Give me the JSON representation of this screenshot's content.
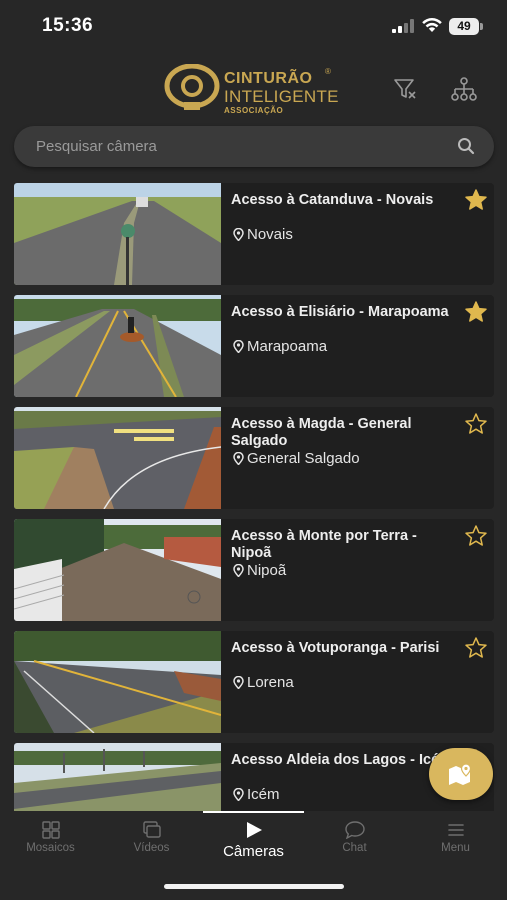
{
  "status_bar": {
    "time": "15:36",
    "battery": "49"
  },
  "header": {
    "logo_line1": "CINTURÃO",
    "logo_line2": "INTELIGENTE",
    "logo_line3": "ASSOCIAÇÃO",
    "logo_reg": "®"
  },
  "search": {
    "placeholder": "Pesquisar câmera"
  },
  "cameras": [
    {
      "title": "Acesso à Catanduva - Novais",
      "location": "Novais",
      "favorite": true
    },
    {
      "title": "Acesso à Elisiário - Marapoama",
      "location": "Marapoama",
      "favorite": true
    },
    {
      "title": "Acesso à Magda - General Salgado",
      "location": "General Salgado",
      "favorite": false
    },
    {
      "title": "Acesso à Monte por Terra - Nipoã",
      "location": "Nipoã",
      "favorite": false
    },
    {
      "title": "Acesso à Votuporanga - Parisi",
      "location": "Lorena",
      "favorite": false
    },
    {
      "title": "Acesso Aldeia dos Lagos - Icém",
      "location": "Icém",
      "favorite": false
    }
  ],
  "nav": {
    "items": [
      {
        "label": "Mosaicos",
        "icon": "grid-icon"
      },
      {
        "label": "Vídeos",
        "icon": "videos-icon"
      },
      {
        "label": "Câmeras",
        "icon": "play-icon",
        "active": true
      },
      {
        "label": "Chat",
        "icon": "chat-icon"
      },
      {
        "label": "Menu",
        "icon": "menu-icon"
      }
    ]
  },
  "colors": {
    "background": "#272727",
    "card": "#1f1f1f",
    "accent_gold": "#d9b75e",
    "logo_gold": "#c9a752"
  }
}
